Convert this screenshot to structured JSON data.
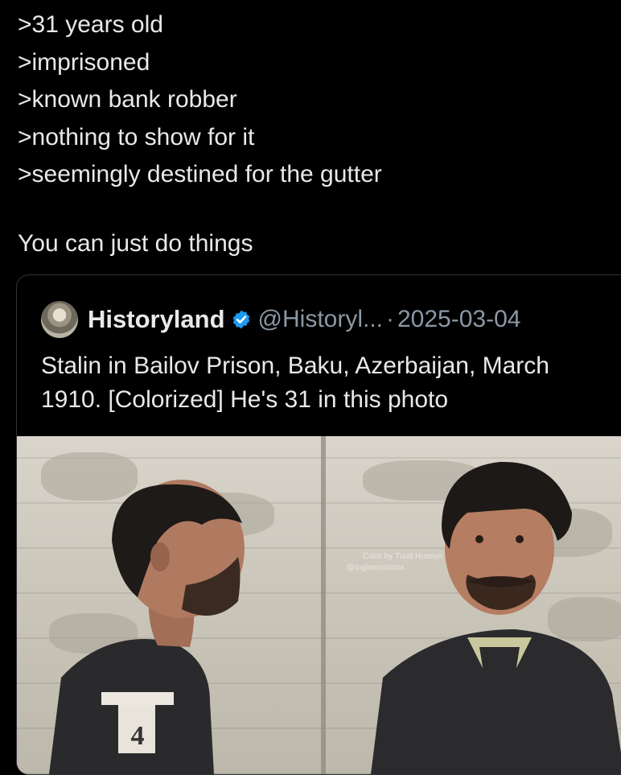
{
  "post": {
    "lines": [
      ">31 years old",
      ">imprisoned",
      ">known bank robber",
      ">nothing to show for it",
      ">seemingly destined for the gutter"
    ],
    "closing": "You can just do things"
  },
  "quote": {
    "display_name": "Historyland",
    "handle": "@Historyl...",
    "separator": "·",
    "date": "2025-03-04",
    "text": "Stalin in Bailov Prison, Baku, Azerbaijan, March 1910. [Colorized] He's 31 in this photo",
    "photo": {
      "watermark_line1": "Color by Tural Huseyn",
      "watermark_line2": "@inglenmistorix",
      "placard_number": "4"
    }
  },
  "colors": {
    "background": "#000000",
    "text": "#e7e9ea",
    "muted": "#8b98a5",
    "verified": "#1d9bf0",
    "border": "#2f3336"
  }
}
